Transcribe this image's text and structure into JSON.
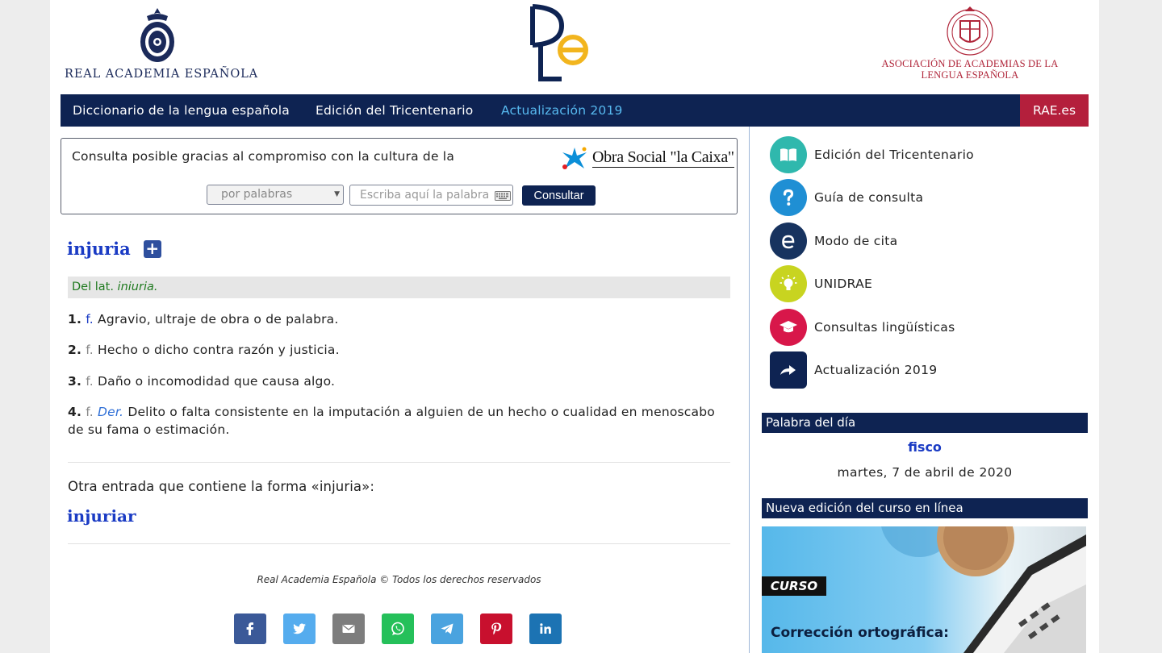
{
  "header": {
    "rae_name": "REAL ACADEMIA ESPAÑOLA",
    "asale_line1": "ASOCIACIÓN DE ACADEMIAS DE LA",
    "asale_line2": "LENGUA ESPAÑOLA"
  },
  "nav": {
    "items": [
      "Diccionario de la lengua española",
      "Edición del Tricentenario",
      "Actualización 2019"
    ],
    "rae": "RAE.es"
  },
  "search": {
    "sponsor_text": "Consulta posible gracias al compromiso con la cultura de la",
    "sponsor_name": "Obra Social \"la Caixa\"",
    "mode": "por palabras",
    "placeholder": "Escriba aquí la palabra",
    "value": "",
    "button": "Consultar"
  },
  "entry": {
    "word": "injuria",
    "etym_prefix": "Del lat.",
    "etym_word": "iniuria.",
    "senses": [
      {
        "num": "1.",
        "gram": "f.",
        "abbr": "",
        "text": "Agravio, ultraje de obra o de palabra."
      },
      {
        "num": "2.",
        "gram": "f.",
        "abbr": "",
        "text": "Hecho o dicho contra razón y justicia."
      },
      {
        "num": "3.",
        "gram": "f.",
        "abbr": "",
        "text": "Daño o incomodidad que causa algo."
      },
      {
        "num": "4.",
        "gram": "f.",
        "abbr": "Der.",
        "text": "Delito o falta consistente en la imputación a alguien de un hecho o cualidad en menoscabo de su fama o estimación."
      }
    ],
    "other_entry_text": "Otra entrada que contiene la forma «injuria»:",
    "related_word": "injuriar"
  },
  "footer": {
    "copyright": "Real Academia Española © Todos los derechos reservados",
    "share": [
      {
        "icon": "facebook-icon",
        "color": "#3b5998"
      },
      {
        "icon": "twitter-icon",
        "color": "#55acee"
      },
      {
        "icon": "email-icon",
        "color": "#7d7d7d"
      },
      {
        "icon": "whatsapp-icon",
        "color": "#25c05a"
      },
      {
        "icon": "telegram-icon",
        "color": "#4aa3df"
      },
      {
        "icon": "pinterest-icon",
        "color": "#c8102e"
      },
      {
        "icon": "linkedin-icon",
        "color": "#1c73b3"
      }
    ]
  },
  "sidebar": {
    "links": [
      {
        "label": "Edición del Tricentenario",
        "icon": "book-icon",
        "color": "#2fb8ad"
      },
      {
        "label": "Guía de consulta",
        "icon": "question-icon",
        "color": "#1f8fd4"
      },
      {
        "label": "Modo de cita",
        "icon": "e-letter-icon",
        "color": "#17335f"
      },
      {
        "label": "UNIDRAE",
        "icon": "lightbulb-icon",
        "color": "#c8d420"
      },
      {
        "label": "Consultas lingüísticas",
        "icon": "graduation-cap-icon",
        "color": "#d8174a"
      },
      {
        "label": "Actualización 2019",
        "icon": "forward-arrow-icon",
        "color": "#0e2352"
      }
    ],
    "word_of_day_title": "Palabra del día",
    "word_of_day": "fisco",
    "word_of_day_date": "martes, 7 de abril de 2020",
    "course_title": "Nueva edición del curso en línea",
    "course_tag": "CURSO",
    "course_name": "Corrección ortográfica:"
  }
}
